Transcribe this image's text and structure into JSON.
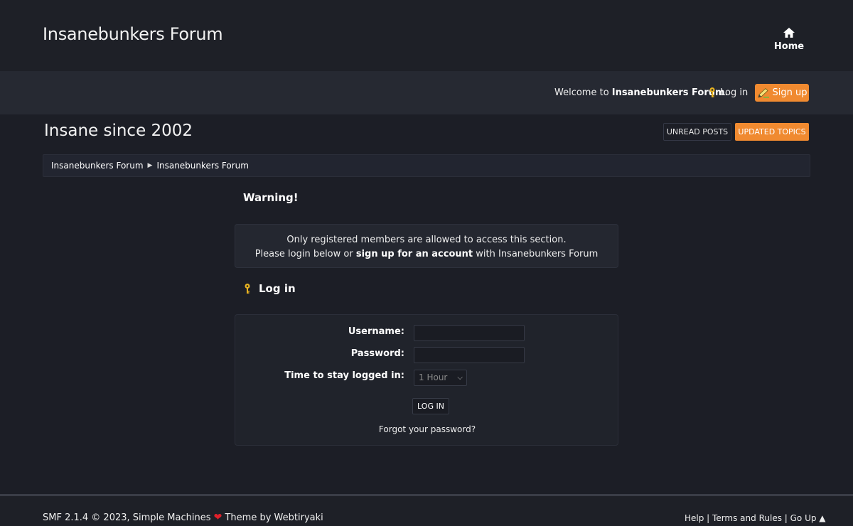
{
  "header": {
    "forum_title": "Insanebunkers Forum",
    "home_label": "Home"
  },
  "userbar": {
    "welcome_prefix": "Welcome to ",
    "welcome_forum": "Insanebunkers Forum",
    "welcome_suffix": ".",
    "login_label": "Log in",
    "signup_label": "Sign up"
  },
  "subheader": {
    "tagline": "Insane since 2002",
    "unread_label": "UNREAD POSTS",
    "updated_label": "UPDATED TOPICS"
  },
  "breadcrumb": {
    "items": [
      "Insanebunkers Forum",
      "Insanebunkers Forum"
    ],
    "separator": "▶"
  },
  "warning": {
    "title": "Warning!",
    "line1": "Only registered members are allowed to access this section.",
    "line2_prefix": "Please login below or ",
    "line2_link": "sign up for an account",
    "line2_suffix": " with Insanebunkers Forum"
  },
  "login": {
    "title": "Log in",
    "username_label": "Username:",
    "password_label": "Password:",
    "stay_label": "Time to stay logged in:",
    "stay_value": "1 Hour",
    "submit_label": "LOG IN",
    "forgot_label": "Forgot your password?"
  },
  "footer": {
    "left_prefix": "SMF 2.1.4 © 2023, Simple Machines ",
    "left_suffix": " Theme by Webtiryaki",
    "help": "Help",
    "terms": "Terms and Rules",
    "goup": "Go Up ▲",
    "divider": " | "
  },
  "colors": {
    "accent": "#f08a30",
    "background": "#1c1e26",
    "heart": "#e0202a"
  }
}
